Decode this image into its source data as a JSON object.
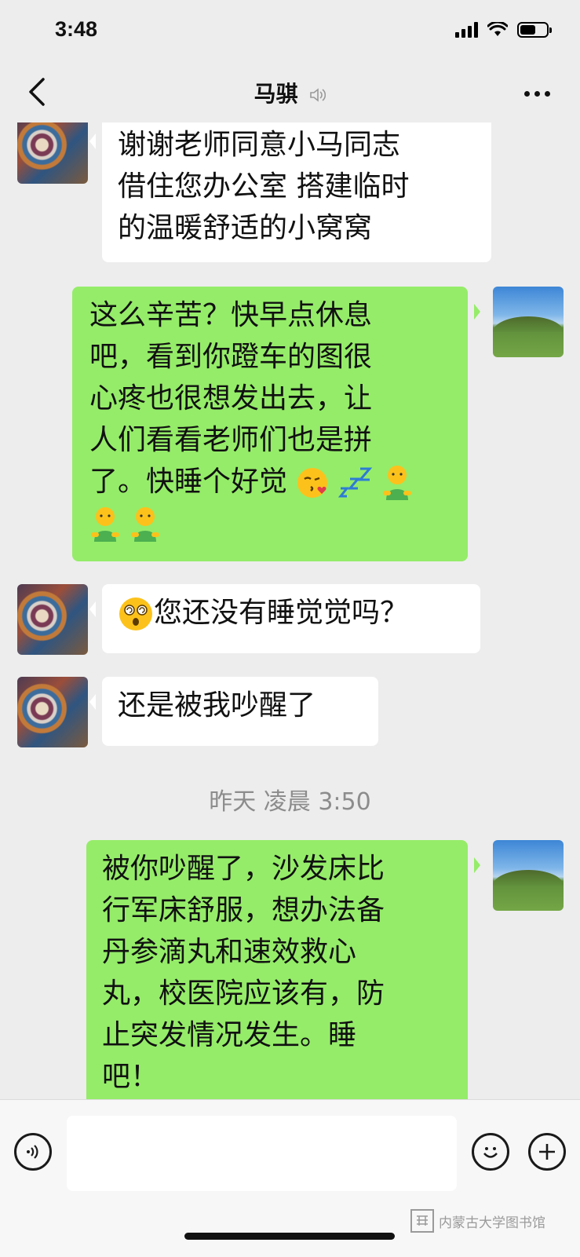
{
  "status_bar": {
    "time": "3:48",
    "battery_level": 0.6
  },
  "nav": {
    "title": "马骐"
  },
  "messages": {
    "m1": {
      "line1": "谢谢老师同意小马同志",
      "line2": "借住您办公室 搭建临时",
      "line3": "的温暖舒适的小窝窝"
    },
    "m2": {
      "line1": "这么辛苦？快早点休息",
      "line2": "吧，看到你蹬车的图很",
      "line3": "心疼也很想发出去，让",
      "line4": "人们看看老师们也是拼",
      "line5": "了。快睡个好觉",
      "emojis": [
        "kiss-emoji",
        "zzz-emoji",
        "hugging-figure-emoji",
        "hugging-figure-emoji",
        "hugging-figure-emoji"
      ]
    },
    "m3": {
      "text": "您还没有睡觉觉吗？",
      "emoji": "dizzy-face-emoji"
    },
    "m4": {
      "text": "还是被我吵醒了"
    },
    "m5": {
      "line1": "被你吵醒了，沙发床比",
      "line2": "行军床舒服，想办法备",
      "line3": "丹参滴丸和速效救心",
      "line4": "丸，校医院应该有，防",
      "line5": "止突发情况发生。睡",
      "line6": "吧！"
    }
  },
  "timestamp": "昨天 凌晨 3:50",
  "input": {
    "placeholder": ""
  },
  "watermark": "内蒙古大学图书馆",
  "colors": {
    "background": "#ededed",
    "incoming_bubble": "#ffffff",
    "outgoing_bubble": "#95ec69",
    "timestamp": "#8c8c8c"
  },
  "icons": {
    "back": "chevron-left-icon",
    "audio": "speaker-icon",
    "more": "more-dots-icon",
    "voice": "voice-icon",
    "emoji": "smiley-icon",
    "plus": "plus-icon"
  }
}
